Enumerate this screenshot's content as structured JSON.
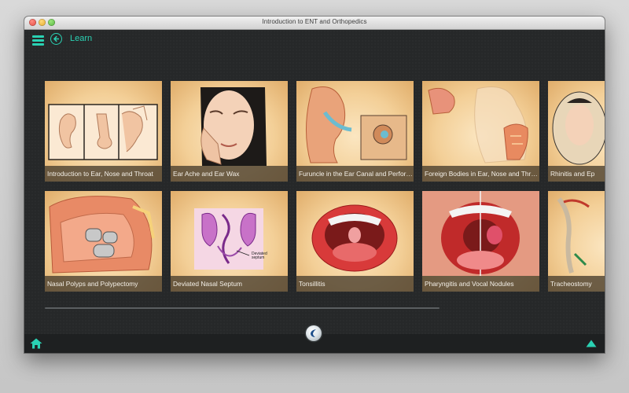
{
  "window": {
    "title": "Introduction to ENT and Orthopedics"
  },
  "header": {
    "title": "Learn"
  },
  "grid": {
    "rows": [
      [
        {
          "title": "Introduction to Ear, Nose and Throat"
        },
        {
          "title": "Ear Ache and Ear Wax"
        },
        {
          "title": "Furuncle in the Ear Canal and Perfora..."
        },
        {
          "title": "Foreign Bodies in Ear, Nose and Throat"
        },
        {
          "title": "Rhinitis and Ep"
        }
      ],
      [
        {
          "title": "Nasal Polyps and Polypectomy"
        },
        {
          "title": "Deviated Nasal Septum",
          "inset_label": "Deviated septum"
        },
        {
          "title": "Tonsillitis"
        },
        {
          "title": "Pharyngitis and Vocal Nodules"
        },
        {
          "title": "Tracheostomy"
        }
      ]
    ]
  },
  "colors": {
    "accent": "#2ad1b3",
    "background": "#262829",
    "card": "#f3cf97"
  },
  "icons": {
    "menu": "hamburger-menu-icon",
    "back": "back-arrow-icon",
    "home": "home-icon",
    "up": "up-arrow-icon",
    "logo": "app-logo-icon"
  }
}
